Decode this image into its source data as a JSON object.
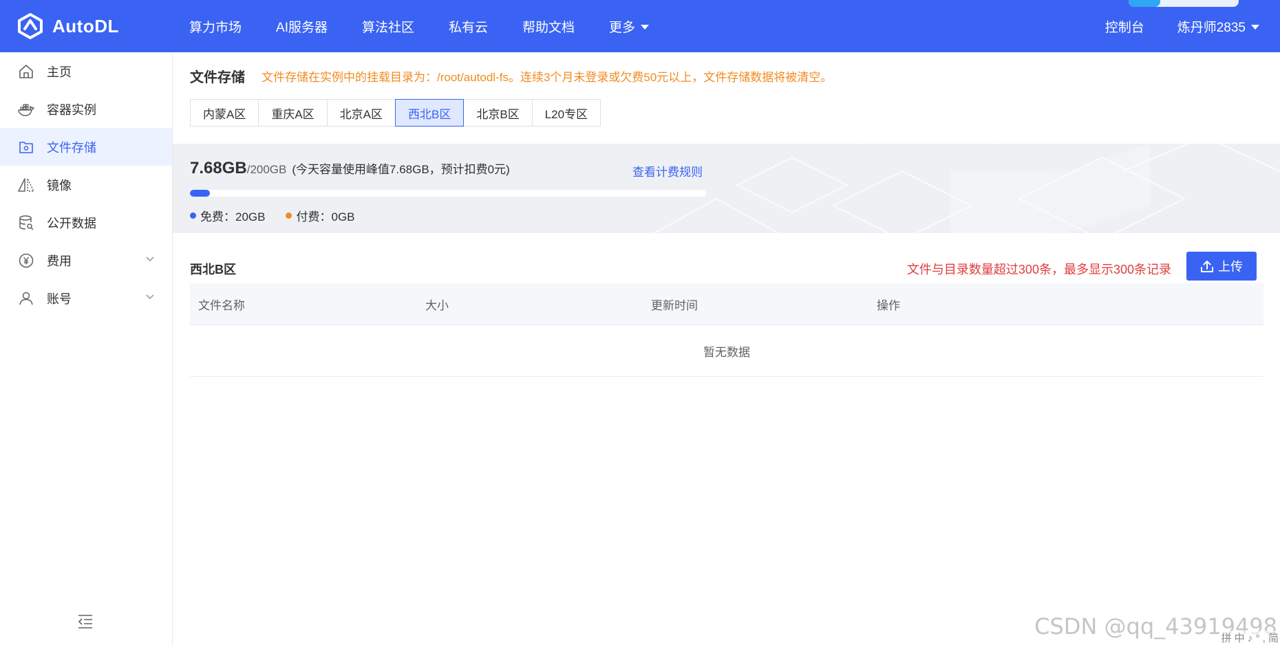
{
  "brand": {
    "name": "AutoDL",
    "color": "#3a63f4"
  },
  "nav": {
    "items": [
      "算力市场",
      "AI服务器",
      "算法社区",
      "私有云",
      "帮助文档",
      "更多"
    ],
    "console": "控制台",
    "user": "炼丹师2835"
  },
  "sidebar": {
    "items": [
      {
        "label": "主页",
        "icon": "home-icon"
      },
      {
        "label": "容器实例",
        "icon": "docker-icon"
      },
      {
        "label": "文件存储",
        "icon": "storage-folder-icon",
        "active": true
      },
      {
        "label": "镜像",
        "icon": "mirror-icon"
      },
      {
        "label": "公开数据",
        "icon": "database-icon"
      },
      {
        "label": "费用",
        "icon": "yen-icon",
        "expandable": true
      },
      {
        "label": "账号",
        "icon": "user-icon",
        "expandable": true
      }
    ]
  },
  "page": {
    "title": "文件存储",
    "notice": "文件存储在实例中的挂载目录为：/root/autodl-fs。连续3个月未登录或欠费50元以上，文件存储数据将被清空。",
    "tabs": [
      "内蒙A区",
      "重庆A区",
      "北京A区",
      "西北B区",
      "北京B区",
      "L20专区"
    ],
    "active_tab": "西北B区"
  },
  "usage": {
    "used": "7.68GB",
    "total": "/200GB",
    "detail": "(今天容量使用峰值7.68GB，预计扣费0元)",
    "rule_link": "查看计费规则",
    "fraction": 0.0384,
    "free_label": "免费：20GB",
    "paid_label": "付费：0GB",
    "free_color": "#3a63f4",
    "paid_color": "#f08c21"
  },
  "region": {
    "name": "西北B区",
    "warning": "文件与目录数量超过300条，最多显示300条记录",
    "upload_label": "上传"
  },
  "table": {
    "columns": [
      "文件名称",
      "大小",
      "更新时间",
      "操作"
    ],
    "empty_text": "暂无数据"
  },
  "watermark": "CSDN @qq_43919498",
  "ime_text": "拼 中 ♪ ° , 简"
}
